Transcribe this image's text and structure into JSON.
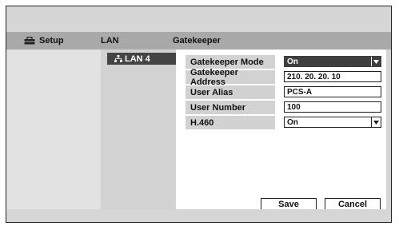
{
  "header": {
    "setup_label": "Setup",
    "lan_label": "LAN",
    "gatekeeper_label": "Gatekeeper"
  },
  "lan_list": {
    "selected_item": "LAN 4"
  },
  "form": {
    "gatekeeper_mode": {
      "label": "Gatekeeper Mode",
      "value": "On"
    },
    "gatekeeper_address": {
      "label": "Gatekeeper Address",
      "value": "210. 20. 20. 10"
    },
    "user_alias": {
      "label": "User Alias",
      "value": "PCS-A"
    },
    "user_number": {
      "label": "User Number",
      "value": "100"
    },
    "h460": {
      "label": "H.460",
      "value": "On"
    }
  },
  "buttons": {
    "save": "Save",
    "cancel": "Cancel"
  },
  "icons": {
    "setup": "toolbox-icon",
    "lan": "network-icon",
    "dropdown": "dropdown-arrow-icon"
  }
}
